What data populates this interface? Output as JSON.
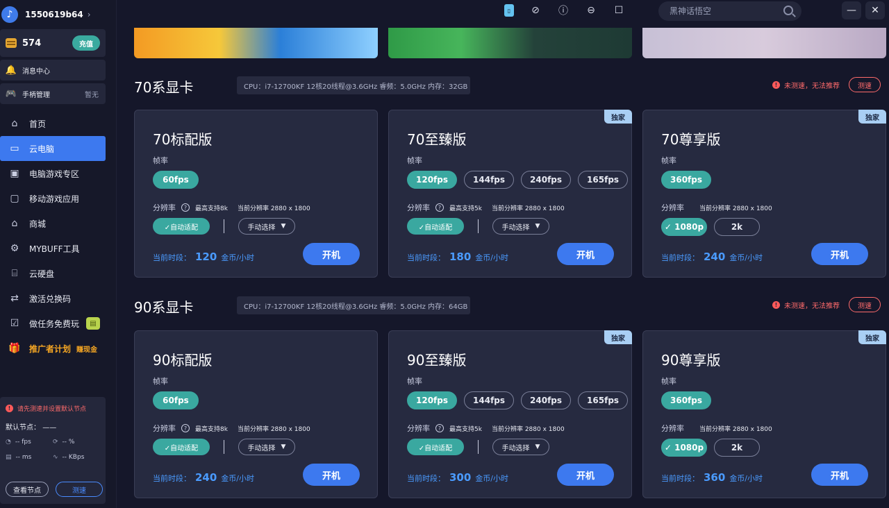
{
  "user": {
    "id": "1550619b64",
    "coins": "574",
    "recharge": "充值"
  },
  "sidebar": {
    "messages": "消息中心",
    "gamepad": "手柄管理",
    "gamepad_status": "暂无",
    "nav": [
      {
        "label": "首页",
        "icon": "home-icon"
      },
      {
        "label": "云电脑",
        "icon": "monitor-icon"
      },
      {
        "label": "电脑游戏专区",
        "icon": "gamepad-icon"
      },
      {
        "label": "移动游戏应用",
        "icon": "mobile-icon"
      },
      {
        "label": "商城",
        "icon": "shop-icon"
      },
      {
        "label": "MYBUFF工具",
        "icon": "tool-icon"
      },
      {
        "label": "云硬盘",
        "icon": "disk-icon"
      },
      {
        "label": "激活兑换码",
        "icon": "exchange-icon"
      },
      {
        "label": "做任务免费玩",
        "icon": "task-icon"
      }
    ],
    "promo": {
      "label": "推广者计划",
      "earn": "赚现金"
    },
    "node": {
      "warning": "请先测速并设置默认节点",
      "default_label": "默认节点：",
      "default_value": "——",
      "fps": "-- fps",
      "loss": "-- %",
      "ping": "-- ms",
      "bandwidth": "-- KBps",
      "view_btn": "查看节点",
      "test_btn": "测速"
    }
  },
  "topbar": {
    "search_placeholder": "黑神话悟空"
  },
  "sections": [
    {
      "title": "70系显卡",
      "cpu": "CPU：i7-12700KF 12核20线程@3.6GHz 睿频：5.0GHz 内存：32GB",
      "untested": "未测速，无法推荐",
      "test_btn": "测速",
      "cards": [
        {
          "title": "70标配版",
          "exclusive": "",
          "fps": [
            "60fps"
          ],
          "max_res": "最高支持8k",
          "cur_res": "当前分辨率 2880 x 1800",
          "mode": "adapt",
          "price": "120"
        },
        {
          "title": "70至臻版",
          "exclusive": "独家",
          "fps": [
            "120fps",
            "144fps",
            "240fps",
            "165fps"
          ],
          "max_res": "最高支持5k",
          "cur_res": "当前分辨率 2880 x 1800",
          "mode": "adapt",
          "price": "180"
        },
        {
          "title": "70尊享版",
          "exclusive": "独家",
          "fps": [
            "360fps"
          ],
          "max_res": "",
          "cur_res": "当前分辨率 2880 x 1800",
          "mode": "fixed",
          "price": "240"
        }
      ]
    },
    {
      "title": "90系显卡",
      "cpu": "CPU：i7-12700KF 12核20线程@3.6GHz 睿频：5.0GHz 内存：64GB",
      "untested": "未测速，无法推荐",
      "test_btn": "测速",
      "cards": [
        {
          "title": "90标配版",
          "exclusive": "",
          "fps": [
            "60fps"
          ],
          "max_res": "最高支持8k",
          "cur_res": "当前分辨率 2880 x 1800",
          "mode": "adapt",
          "price": "240"
        },
        {
          "title": "90至臻版",
          "exclusive": "独家",
          "fps": [
            "120fps",
            "144fps",
            "240fps",
            "165fps"
          ],
          "max_res": "最高支持5k",
          "cur_res": "当前分辨率 2880 x 1800",
          "mode": "adapt",
          "price": "300"
        },
        {
          "title": "90尊享版",
          "exclusive": "独家",
          "fps": [
            "360fps"
          ],
          "max_res": "",
          "cur_res": "当前分辨率 2880 x 1800",
          "mode": "fixed",
          "price": "360"
        }
      ]
    }
  ],
  "labels": {
    "frame_rate": "帧率",
    "resolution": "分辨率",
    "auto_adapt": "✓自动适配",
    "manual": "手动选择",
    "res_1080": "✓ 1080p",
    "res_2k": "2k",
    "price_prefix": "当前时段：",
    "price_unit": "金币/小时",
    "start": "开机"
  },
  "colors": {
    "accent": "#3d79ef",
    "teal": "#3aa8a0",
    "warning": "#ff6b6b",
    "coin": "#e5a631",
    "promo": "#f5a623"
  }
}
